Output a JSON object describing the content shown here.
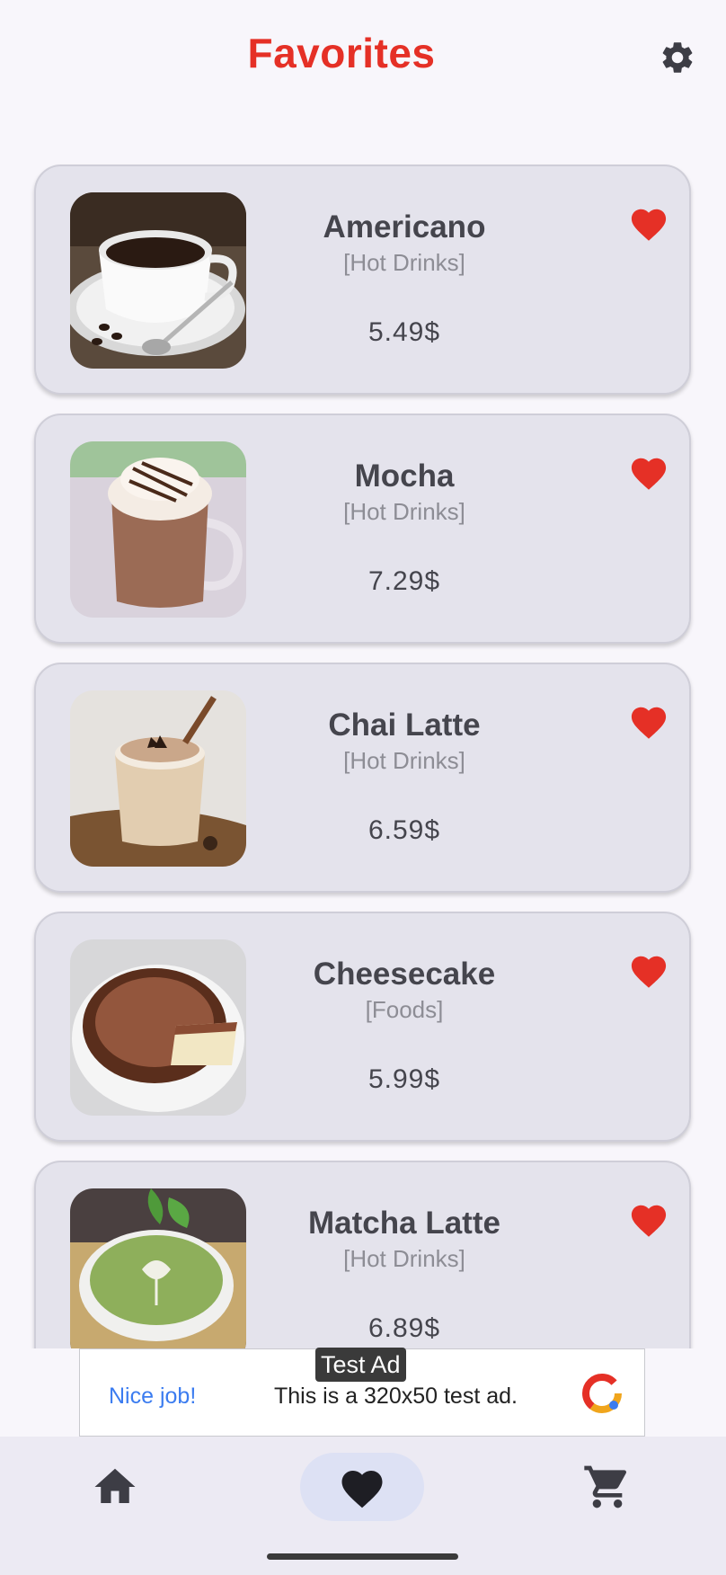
{
  "header": {
    "title": "Favorites",
    "settings_icon": "gear-icon"
  },
  "colors": {
    "accent": "#e53026",
    "card": "#e4e3ec",
    "nav_active": "#dde1f4"
  },
  "items": [
    {
      "name": "Americano",
      "category": "[Hot Drinks]",
      "price": "5.49$",
      "favorite": true
    },
    {
      "name": "Mocha",
      "category": "[Hot Drinks]",
      "price": "7.29$",
      "favorite": true
    },
    {
      "name": "Chai Latte",
      "category": "[Hot Drinks]",
      "price": "6.59$",
      "favorite": true
    },
    {
      "name": "Cheesecake",
      "category": "[Foods]",
      "price": "5.99$",
      "favorite": true
    },
    {
      "name": "Matcha Latte",
      "category": "[Hot Drinks]",
      "price": "6.89$",
      "favorite": true
    }
  ],
  "ad": {
    "badge": "Test Ad",
    "cta": "Nice job!",
    "text": "This is a 320x50 test ad."
  },
  "nav": [
    {
      "label": "home",
      "icon": "home-icon",
      "active": false
    },
    {
      "label": "favorites",
      "icon": "heart-icon",
      "active": true
    },
    {
      "label": "cart",
      "icon": "cart-icon",
      "active": false
    }
  ]
}
